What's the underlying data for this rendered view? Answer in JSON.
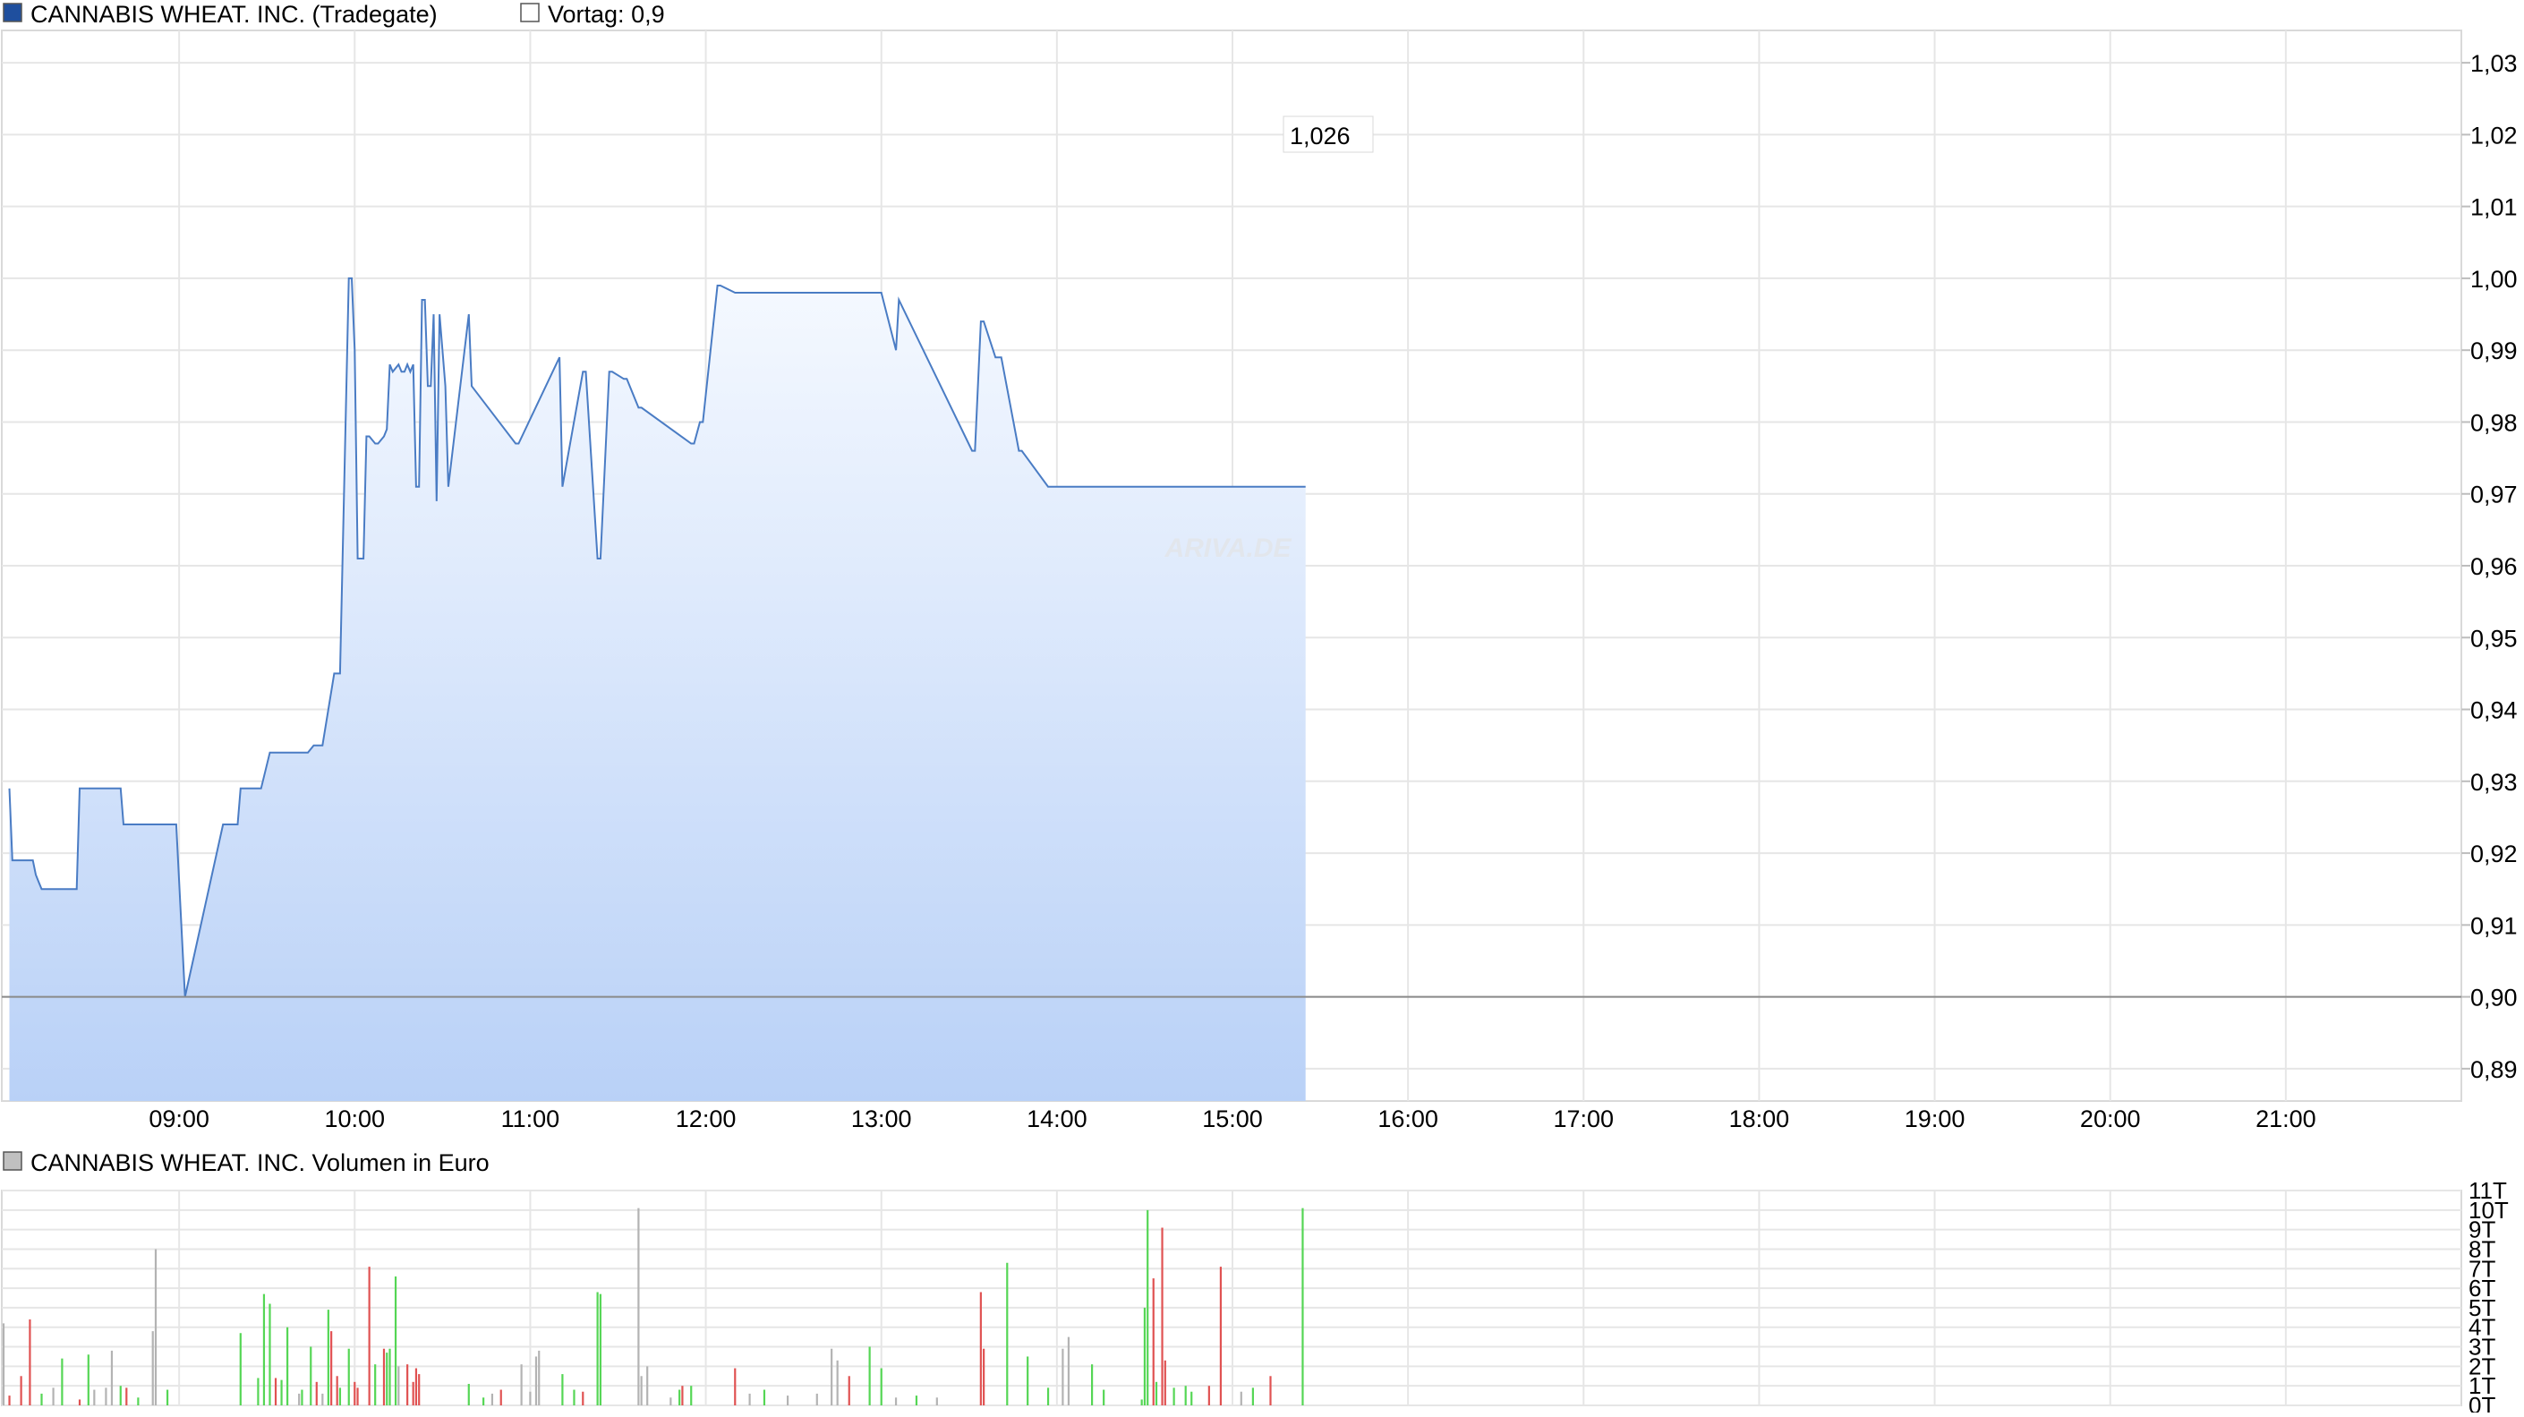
{
  "chart_data": [
    {
      "type": "area",
      "legend": [
        {
          "label": "CANNABIS WHEAT. INC. (Tradegate)",
          "color": "#1f4f9e",
          "style": "filled"
        },
        {
          "label": "Vortag: 0,9",
          "color": "#ffffff",
          "style": "outline"
        }
      ],
      "x_ticks": [
        "09:00",
        "10:00",
        "11:00",
        "12:00",
        "13:00",
        "14:00",
        "15:00",
        "16:00",
        "17:00",
        "18:00",
        "19:00",
        "20:00",
        "21:00"
      ],
      "y_ticks": [
        "0,89",
        "0,90",
        "0,91",
        "0,92",
        "0,93",
        "0,94",
        "0,95",
        "0,96",
        "0,97",
        "0,98",
        "0,99",
        "1,00",
        "1,01",
        "1,02",
        "1,03"
      ],
      "x_range": [
        "08:00",
        "22:00"
      ],
      "ylim": [
        0.8855,
        1.0345
      ],
      "reference_line": 0.9,
      "last_value_label": "1,026",
      "watermark": "ARIVA.DE",
      "grid": true,
      "series": [
        {
          "line_color": "#4a7cc4",
          "fill_top_color": "#f5f9ff",
          "fill_bottom_color": "#b9d1f7",
          "x": [
            "08:02",
            "08:03",
            "08:04",
            "08:10",
            "08:11",
            "08:12",
            "08:13",
            "08:15",
            "08:20",
            "08:25",
            "08:26",
            "08:28",
            "08:40",
            "08:41",
            "08:43",
            "08:50",
            "08:52",
            "08:54",
            "08:59",
            "09:02",
            "09:15",
            "09:20",
            "09:21",
            "09:22",
            "09:23",
            "09:26",
            "09:28",
            "09:31",
            "09:32",
            "09:34",
            "09:35",
            "09:39",
            "09:43",
            "09:44",
            "09:46",
            "09:47",
            "09:49",
            "09:53",
            "09:55",
            "09:58",
            "09:59",
            "10:00",
            "10:01",
            "10:03",
            "10:04",
            "10:05",
            "10:07",
            "10:08",
            "10:10",
            "10:11",
            "10:12",
            "10:13",
            "10:15",
            "10:16",
            "10:17",
            "10:18",
            "10:19",
            "10:20",
            "10:21",
            "10:22",
            "10:23",
            "10:24",
            "10:25",
            "10:26",
            "10:27",
            "10:28",
            "10:29",
            "10:31",
            "10:32",
            "10:39",
            "10:40",
            "10:55",
            "10:56",
            "11:10",
            "11:11",
            "11:18",
            "11:19",
            "11:23",
            "11:24",
            "11:27",
            "11:28",
            "11:32",
            "11:33",
            "11:37",
            "11:38",
            "11:55",
            "11:56",
            "11:58",
            "11:59",
            "12:04",
            "12:05",
            "12:10",
            "12:11",
            "12:16",
            "12:17",
            "12:53",
            "12:54",
            "12:59",
            "13:00",
            "13:05",
            "13:06",
            "13:31",
            "13:32",
            "13:34",
            "13:35",
            "13:39",
            "13:40",
            "13:41",
            "13:47",
            "13:48",
            "13:57",
            "13:58",
            "14:06",
            "14:07",
            "14:21",
            "14:22",
            "14:28",
            "14:29",
            "14:30",
            "14:31",
            "14:32",
            "14:33",
            "14:34",
            "14:35",
            "14:37",
            "14:38",
            "14:53",
            "14:54",
            "14:55",
            "15:00",
            "15:01",
            "15:09",
            "15:10",
            "15:11",
            "15:12",
            "15:16",
            "15:17",
            "15:20",
            "15:21",
            "15:22",
            "15:23",
            "15:25"
          ],
          "values": [
            0.929,
            0.919,
            0.919,
            0.919,
            0.917,
            0.916,
            0.915,
            0.915,
            0.915,
            0.915,
            0.929,
            0.929,
            0.929,
            0.924,
            0.924,
            0.924,
            0.924,
            0.924,
            0.924,
            0.9,
            0.924,
            0.924,
            0.929,
            0.929,
            0.929,
            0.929,
            0.929,
            0.934,
            0.934,
            0.934,
            0.934,
            0.934,
            0.934,
            0.934,
            0.935,
            0.935,
            0.935,
            0.945,
            0.945,
            1.0,
            1.0,
            0.99,
            0.961,
            0.961,
            0.978,
            0.978,
            0.977,
            0.977,
            0.978,
            0.979,
            0.988,
            0.987,
            0.988,
            0.987,
            0.987,
            0.988,
            0.987,
            0.988,
            0.971,
            0.971,
            0.997,
            0.997,
            0.985,
            0.985,
            0.995,
            0.969,
            0.995,
            0.985,
            0.971,
            0.995,
            0.985,
            0.977,
            0.977,
            0.989,
            0.971,
            0.987,
            0.987,
            0.961,
            0.961,
            0.987,
            0.987,
            0.986,
            0.986,
            0.982,
            0.982,
            0.977,
            0.977,
            0.98,
            0.98,
            0.999,
            0.999,
            0.998,
            0.998,
            0.998,
            0.998,
            0.998,
            0.998,
            0.998,
            0.998,
            0.99,
            0.997,
            0.976,
            0.976,
            0.994,
            0.994,
            0.989,
            0.989,
            0.989,
            0.976,
            0.976,
            0.971,
            0.971,
            0.971,
            0.971,
            0.971,
            0.971,
            0.971,
            0.971,
            0.971,
            0.971,
            0.971,
            0.971,
            0.971,
            0.971,
            0.971,
            0.971,
            0.971,
            0.971,
            0.971,
            0.971,
            0.971,
            0.971,
            0.971,
            0.971,
            0.971,
            0.971,
            0.971,
            0.971,
            0.971,
            0.971,
            0.971,
            0.971
          ],
          "_note": ""
        }
      ]
    },
    {
      "type": "bar",
      "legend": [
        {
          "label": "CANNABIS WHEAT. INC. Volumen in Euro",
          "color": "#c0c0c0",
          "style": "filled"
        }
      ],
      "y_ticks": [
        "0T",
        "1T",
        "2T",
        "3T",
        "4T",
        "5T",
        "6T",
        "7T",
        "8T",
        "9T",
        "10T",
        "11T"
      ],
      "ylim": [
        0,
        11
      ],
      "grid": true,
      "colors": {
        "up": "#55d655",
        "down": "#e05252",
        "neutral": "#b3b3b3"
      },
      "bars": [
        {
          "t": "08:00",
          "v": 4.2,
          "c": "neutral"
        },
        {
          "t": "08:02",
          "v": 0.5,
          "c": "down"
        },
        {
          "t": "08:06",
          "v": 1.5,
          "c": "down"
        },
        {
          "t": "08:09",
          "v": 4.4,
          "c": "down"
        },
        {
          "t": "08:13",
          "v": 0.6,
          "c": "up"
        },
        {
          "t": "08:17",
          "v": 0.9,
          "c": "neutral"
        },
        {
          "t": "08:20",
          "v": 2.4,
          "c": "up"
        },
        {
          "t": "08:26",
          "v": 0.3,
          "c": "down"
        },
        {
          "t": "08:29",
          "v": 2.6,
          "c": "up"
        },
        {
          "t": "08:31",
          "v": 0.8,
          "c": "neutral"
        },
        {
          "t": "08:35",
          "v": 0.9,
          "c": "neutral"
        },
        {
          "t": "08:37",
          "v": 2.8,
          "c": "neutral"
        },
        {
          "t": "08:40",
          "v": 1.0,
          "c": "up"
        },
        {
          "t": "08:42",
          "v": 0.9,
          "c": "down"
        },
        {
          "t": "08:46",
          "v": 0.4,
          "c": "up"
        },
        {
          "t": "08:51",
          "v": 3.8,
          "c": "neutral"
        },
        {
          "t": "08:52",
          "v": 8.0,
          "c": "neutral"
        },
        {
          "t": "08:56",
          "v": 0.8,
          "c": "up"
        },
        {
          "t": "09:21",
          "v": 3.7,
          "c": "up"
        },
        {
          "t": "09:27",
          "v": 1.4,
          "c": "up"
        },
        {
          "t": "09:29",
          "v": 5.7,
          "c": "up"
        },
        {
          "t": "09:31",
          "v": 5.2,
          "c": "up"
        },
        {
          "t": "09:33",
          "v": 1.4,
          "c": "down"
        },
        {
          "t": "09:35",
          "v": 1.3,
          "c": "up"
        },
        {
          "t": "09:37",
          "v": 4.0,
          "c": "up"
        },
        {
          "t": "09:41",
          "v": 0.6,
          "c": "neutral"
        },
        {
          "t": "09:42",
          "v": 0.8,
          "c": "up"
        },
        {
          "t": "09:45",
          "v": 3.0,
          "c": "up"
        },
        {
          "t": "09:47",
          "v": 1.2,
          "c": "down"
        },
        {
          "t": "09:49",
          "v": 0.6,
          "c": "neutral"
        },
        {
          "t": "09:51",
          "v": 4.9,
          "c": "up"
        },
        {
          "t": "09:52",
          "v": 3.8,
          "c": "down"
        },
        {
          "t": "09:54",
          "v": 1.5,
          "c": "down"
        },
        {
          "t": "09:55",
          "v": 0.9,
          "c": "up"
        },
        {
          "t": "09:58",
          "v": 2.9,
          "c": "up"
        },
        {
          "t": "10:00",
          "v": 1.2,
          "c": "down"
        },
        {
          "t": "10:01",
          "v": 0.9,
          "c": "down"
        },
        {
          "t": "10:05",
          "v": 7.1,
          "c": "down"
        },
        {
          "t": "10:07",
          "v": 2.1,
          "c": "up"
        },
        {
          "t": "10:10",
          "v": 2.9,
          "c": "down"
        },
        {
          "t": "10:11",
          "v": 2.7,
          "c": "up"
        },
        {
          "t": "10:12",
          "v": 2.9,
          "c": "up"
        },
        {
          "t": "10:14",
          "v": 6.6,
          "c": "up"
        },
        {
          "t": "10:15",
          "v": 2.0,
          "c": "neutral"
        },
        {
          "t": "10:18",
          "v": 2.1,
          "c": "down"
        },
        {
          "t": "10:20",
          "v": 1.2,
          "c": "down"
        },
        {
          "t": "10:21",
          "v": 1.9,
          "c": "down"
        },
        {
          "t": "10:22",
          "v": 1.6,
          "c": "down"
        },
        {
          "t": "10:39",
          "v": 1.1,
          "c": "up"
        },
        {
          "t": "10:44",
          "v": 0.4,
          "c": "up"
        },
        {
          "t": "10:47",
          "v": 0.6,
          "c": "neutral"
        },
        {
          "t": "10:50",
          "v": 0.8,
          "c": "down"
        },
        {
          "t": "10:57",
          "v": 2.1,
          "c": "neutral"
        },
        {
          "t": "11:00",
          "v": 0.7,
          "c": "neutral"
        },
        {
          "t": "11:02",
          "v": 2.5,
          "c": "neutral"
        },
        {
          "t": "11:03",
          "v": 2.8,
          "c": "neutral"
        },
        {
          "t": "11:11",
          "v": 1.6,
          "c": "up"
        },
        {
          "t": "11:15",
          "v": 0.8,
          "c": "up"
        },
        {
          "t": "11:18",
          "v": 0.7,
          "c": "down"
        },
        {
          "t": "11:23",
          "v": 5.8,
          "c": "up"
        },
        {
          "t": "11:24",
          "v": 5.7,
          "c": "up"
        },
        {
          "t": "11:37",
          "v": 10.1,
          "c": "neutral"
        },
        {
          "t": "11:38",
          "v": 1.5,
          "c": "neutral"
        },
        {
          "t": "11:40",
          "v": 2.0,
          "c": "neutral"
        },
        {
          "t": "11:48",
          "v": 0.4,
          "c": "neutral"
        },
        {
          "t": "11:51",
          "v": 0.8,
          "c": "up"
        },
        {
          "t": "11:52",
          "v": 1.0,
          "c": "down"
        },
        {
          "t": "11:55",
          "v": 1.0,
          "c": "up"
        },
        {
          "t": "12:10",
          "v": 1.9,
          "c": "down"
        },
        {
          "t": "12:15",
          "v": 0.6,
          "c": "neutral"
        },
        {
          "t": "12:20",
          "v": 0.8,
          "c": "up"
        },
        {
          "t": "12:28",
          "v": 0.5,
          "c": "neutral"
        },
        {
          "t": "12:38",
          "v": 0.6,
          "c": "neutral"
        },
        {
          "t": "12:43",
          "v": 2.9,
          "c": "neutral"
        },
        {
          "t": "12:45",
          "v": 2.3,
          "c": "neutral"
        },
        {
          "t": "12:49",
          "v": 1.5,
          "c": "down"
        },
        {
          "t": "12:56",
          "v": 3.0,
          "c": "up"
        },
        {
          "t": "13:00",
          "v": 1.9,
          "c": "up"
        },
        {
          "t": "13:05",
          "v": 0.4,
          "c": "neutral"
        },
        {
          "t": "13:12",
          "v": 0.5,
          "c": "up"
        },
        {
          "t": "13:19",
          "v": 0.4,
          "c": "neutral"
        },
        {
          "t": "13:34",
          "v": 5.8,
          "c": "down"
        },
        {
          "t": "13:35",
          "v": 2.9,
          "c": "down"
        },
        {
          "t": "13:43",
          "v": 7.3,
          "c": "up"
        },
        {
          "t": "13:50",
          "v": 2.5,
          "c": "up"
        },
        {
          "t": "13:57",
          "v": 0.9,
          "c": "up"
        },
        {
          "t": "14:02",
          "v": 2.9,
          "c": "neutral"
        },
        {
          "t": "14:04",
          "v": 3.5,
          "c": "neutral"
        },
        {
          "t": "14:12",
          "v": 2.1,
          "c": "up"
        },
        {
          "t": "14:16",
          "v": 0.8,
          "c": "up"
        },
        {
          "t": "14:29",
          "v": 0.3,
          "c": "up"
        },
        {
          "t": "14:30",
          "v": 5.0,
          "c": "up"
        },
        {
          "t": "14:31",
          "v": 10.0,
          "c": "up"
        },
        {
          "t": "14:33",
          "v": 6.5,
          "c": "down"
        },
        {
          "t": "14:34",
          "v": 1.2,
          "c": "up"
        },
        {
          "t": "14:36",
          "v": 9.1,
          "c": "down"
        },
        {
          "t": "14:37",
          "v": 2.3,
          "c": "down"
        },
        {
          "t": "14:40",
          "v": 0.9,
          "c": "up"
        },
        {
          "t": "14:44",
          "v": 1.0,
          "c": "up"
        },
        {
          "t": "14:46",
          "v": 0.7,
          "c": "up"
        },
        {
          "t": "14:52",
          "v": 1.0,
          "c": "down"
        },
        {
          "t": "14:56",
          "v": 7.1,
          "c": "down"
        },
        {
          "t": "15:03",
          "v": 0.7,
          "c": "neutral"
        },
        {
          "t": "15:07",
          "v": 0.9,
          "c": "up"
        },
        {
          "t": "15:13",
          "v": 1.5,
          "c": "down"
        },
        {
          "t": "15:24",
          "v": 10.1,
          "c": "up"
        }
      ]
    }
  ]
}
